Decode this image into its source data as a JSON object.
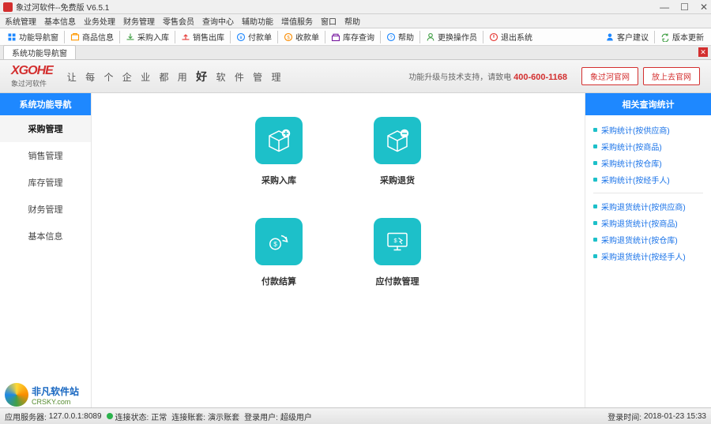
{
  "window": {
    "title": "象过河软件--免费版 V6.5.1"
  },
  "menubar": [
    "系统管理",
    "基本信息",
    "业务处理",
    "财务管理",
    "零售会员",
    "查询中心",
    "辅助功能",
    "增值服务",
    "窗口",
    "帮助"
  ],
  "toolbar": {
    "items": [
      {
        "label": "功能导航窗"
      },
      {
        "label": "商品信息"
      },
      {
        "label": "采购入库"
      },
      {
        "label": "销售出库"
      },
      {
        "label": "付款单"
      },
      {
        "label": "收款单"
      },
      {
        "label": "库存查询"
      },
      {
        "label": "帮助"
      },
      {
        "label": "更换操作员"
      },
      {
        "label": "退出系统"
      }
    ],
    "right": [
      {
        "label": "客户建议"
      },
      {
        "label": "版本更新"
      }
    ]
  },
  "tabs": {
    "active": "系统功能导航窗"
  },
  "banner": {
    "logo": "XGOHE",
    "logo_sub": "象过河软件",
    "slogan_pre": "让 每 个 企 业 都 用",
    "slogan_big": "好",
    "slogan_post": "软 件 管 理",
    "support": "功能升级与技术支持，请致电",
    "phone": "400-600-1168",
    "btn1": "象过河官网",
    "btn2": "放上去官网"
  },
  "sidebar": {
    "title": "系统功能导航",
    "items": [
      "采购管理",
      "销售管理",
      "库存管理",
      "财务管理",
      "基本信息"
    ],
    "active": 0
  },
  "main": {
    "cards_row1": [
      {
        "label": "采购入库",
        "icon": "box-plus"
      },
      {
        "label": "采购退货",
        "icon": "box-minus"
      }
    ],
    "cards_row2": [
      {
        "label": "付款结算",
        "icon": "money-cycle"
      },
      {
        "label": "应付款管理",
        "icon": "screen-money"
      }
    ]
  },
  "rightbar": {
    "title": "相关查询统计",
    "group1": [
      "采购统计(按供应商)",
      "采购统计(按商品)",
      "采购统计(按仓库)",
      "采购统计(按经手人)"
    ],
    "group2": [
      "采购退货统计(按供应商)",
      "采购退货统计(按商品)",
      "采购退货统计(按仓库)",
      "采购退货统计(按经手人)"
    ]
  },
  "status": {
    "server_label": "应用服务器:",
    "server": "127.0.0.1:8089",
    "conn_label": "连接状态:",
    "conn": "正常",
    "account_label": "连接账套:",
    "account": "演示账套",
    "user_label": "登录用户:",
    "user": "超级用户",
    "time_label": "登录时间:",
    "time": "2018-01-23 15:33"
  },
  "watermark": {
    "name": "非凡软件站",
    "url": "CRSKY.com"
  }
}
